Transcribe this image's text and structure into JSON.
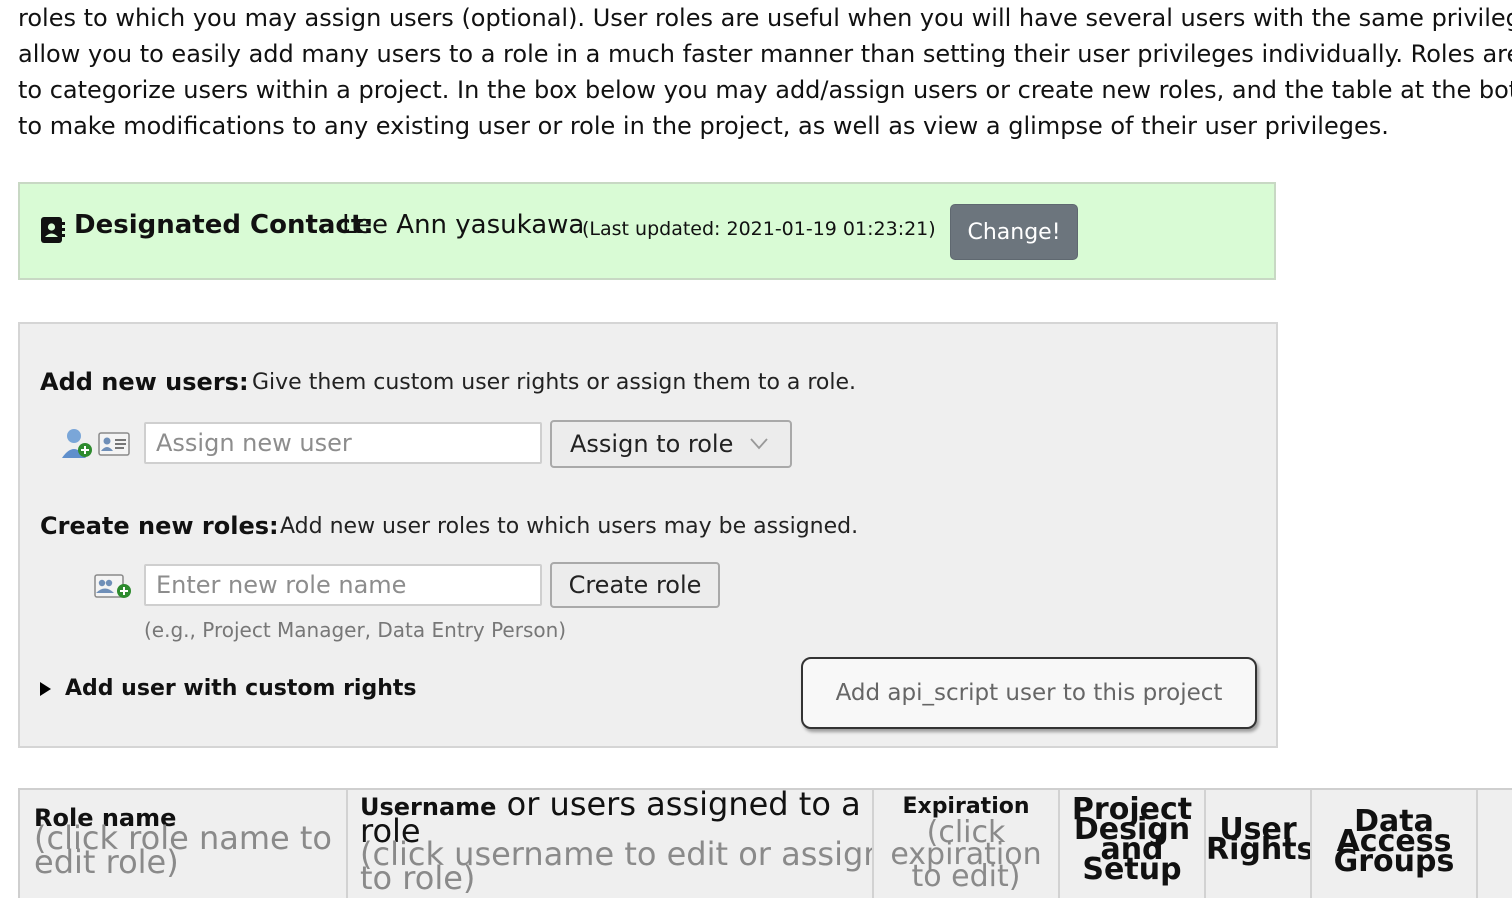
{
  "intro": {
    "lines": [
      "roles to which you may assign users (optional). User roles are useful when you will have several users with the same privileg",
      "allow you to easily add many users to a role in a much faster manner than setting their user privileges individually. Roles are",
      "to categorize users within a project. In the box below you may add/assign users or create new roles, and the table at the bot",
      "to make modifications to any existing user or role in the project, as well as view a glimpse of their user privileges."
    ]
  },
  "contact": {
    "label": "Designated Contact:",
    "name": "Lee Ann yasukawa",
    "last_updated": "(Last updated: 2021-01-19 01:23:21)",
    "change_button": "Change!"
  },
  "add_users": {
    "title": "Add new users:",
    "description": "Give them custom user rights or assign them to a role.",
    "input_placeholder": "Assign new user",
    "assign_role_button": "Assign to role"
  },
  "create_roles": {
    "title": "Create new roles:",
    "description": "Add new user roles to which users may be assigned.",
    "input_placeholder": "Enter new role name",
    "create_button": "Create role",
    "example": "(e.g., Project Manager, Data Entry Person)"
  },
  "custom_rights_toggle": "Add user with custom rights",
  "api_button": "Add api_script user to this project",
  "table": {
    "role_name": {
      "title": "Role name",
      "hint_line1": "(click role name to",
      "hint_line2": "edit role)"
    },
    "username": {
      "title": "Username",
      "title_rest": " or users assigned to a",
      "title_line2": "role",
      "hint_line1": "(click username to edit or assign",
      "hint_line2": "to role)"
    },
    "expiration": {
      "title": "Expiration",
      "hint_line1": "(click",
      "hint_line2": "expiration",
      "hint_line3": "to edit)"
    },
    "project_design": {
      "line1": "Project",
      "line2": "Design",
      "line3": "and",
      "line4": "Setup"
    },
    "user_rights": {
      "line1": "User",
      "line2": "Rights"
    },
    "dag": {
      "line1": "Data",
      "line2": "Access",
      "line3": "Groups"
    }
  },
  "colors": {
    "contact_bg": "#d9fbd5",
    "panel_bg": "#efefef",
    "change_button_bg": "#6c757d"
  },
  "icons": {
    "contact": "contact-card-icon",
    "add_user": "user-add-icon",
    "user_card": "user-card-icon",
    "role_add": "role-card-add-icon",
    "dropdown": "chevron-down-icon",
    "toggle": "triangle-right-icon"
  }
}
